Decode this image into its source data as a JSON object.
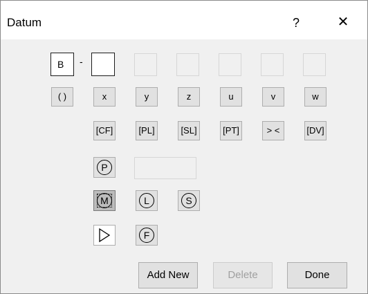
{
  "window": {
    "title": "Datum",
    "help_label": "?",
    "close_label": "✕"
  },
  "datum_row": {
    "prefix_value": "B",
    "separator": "-",
    "suffix_value": ""
  },
  "axis_buttons": [
    "( )",
    "x",
    "y",
    "z",
    "u",
    "v",
    "w"
  ],
  "modifier_buttons": [
    "[CF]",
    "[PL]",
    "[SL]",
    "[PT]",
    "> <",
    "[DV]"
  ],
  "symbols": {
    "projected": "P",
    "mmc": "M",
    "lmc": "L",
    "rfs": "S",
    "free_state": "F"
  },
  "icons": {
    "translation": "translation-triangle-icon"
  },
  "actions": {
    "add_new": "Add New",
    "delete": "Delete",
    "done": "Done"
  },
  "states": {
    "delete_enabled": false,
    "mmc_selected": true
  }
}
